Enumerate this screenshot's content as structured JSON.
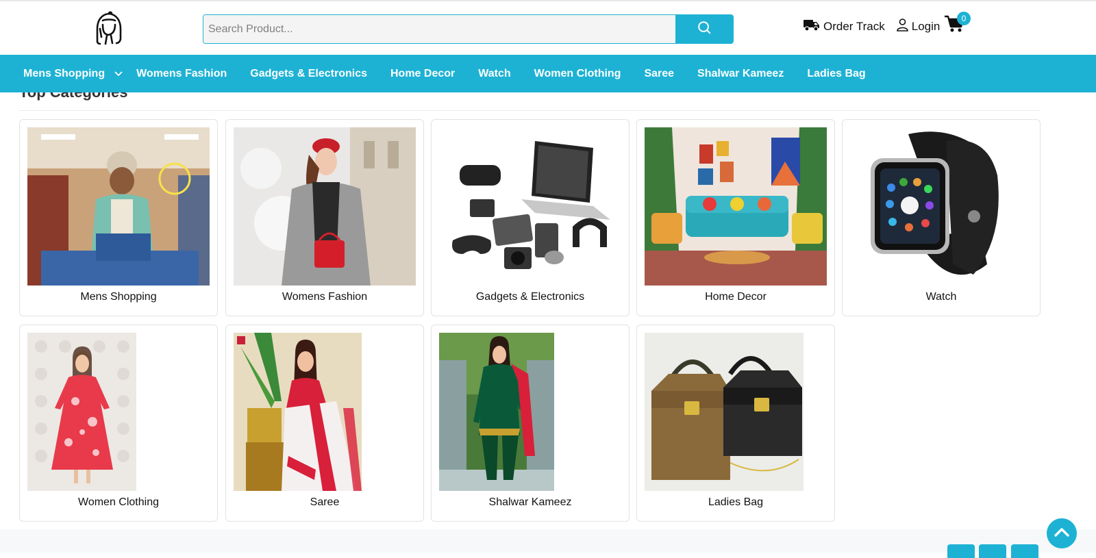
{
  "header": {
    "search_placeholder": "Search Product...",
    "order_track_label": "Order Track",
    "login_label": "Login",
    "cart_count": "0"
  },
  "nav": {
    "items": [
      {
        "label": "Mens Shopping"
      },
      {
        "label": "Womens Fashion"
      },
      {
        "label": "Gadgets & Electronics"
      },
      {
        "label": "Home Decor"
      },
      {
        "label": "Watch"
      },
      {
        "label": "Women Clothing"
      },
      {
        "label": "Saree"
      },
      {
        "label": "Shalwar Kameez"
      },
      {
        "label": "Ladies Bag"
      }
    ]
  },
  "section": {
    "title": "Top Categories"
  },
  "categories": [
    {
      "label": "Mens Shopping"
    },
    {
      "label": "Womens Fashion"
    },
    {
      "label": "Gadgets & Electronics"
    },
    {
      "label": "Home Decor"
    },
    {
      "label": "Watch"
    },
    {
      "label": "Women Clothing"
    },
    {
      "label": "Saree"
    },
    {
      "label": "Shalwar Kameez"
    },
    {
      "label": "Ladies Bag"
    }
  ],
  "colors": {
    "accent": "#1db2d4"
  }
}
